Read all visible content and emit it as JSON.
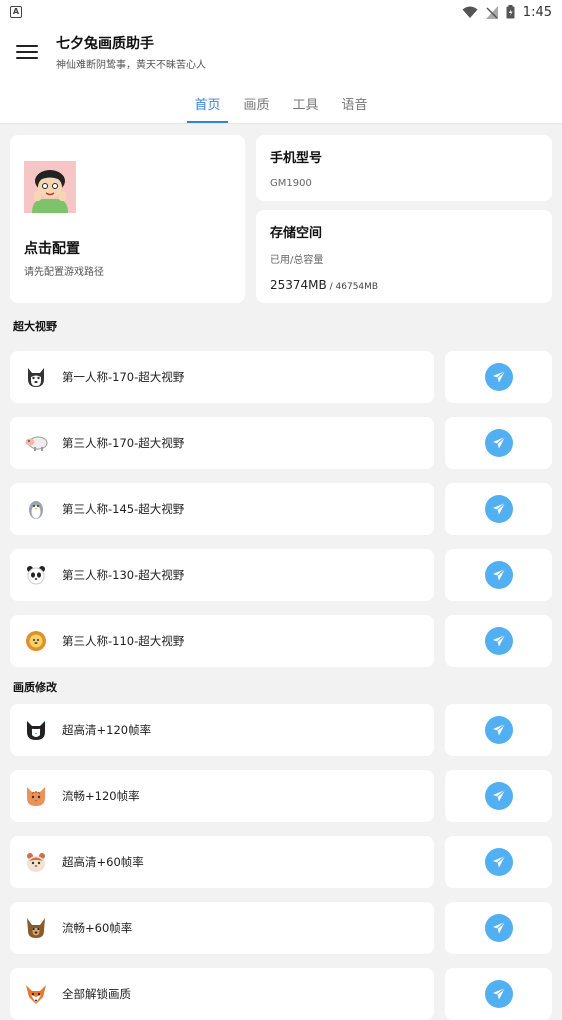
{
  "status_bar": {
    "time": "1:45",
    "app_badge": "A"
  },
  "app": {
    "title": "七夕兔画质助手",
    "subtitle": "神仙难断阴鸷事，黄天不昧苦心人"
  },
  "tabs": [
    {
      "label": "首页",
      "active": true
    },
    {
      "label": "画质",
      "active": false
    },
    {
      "label": "工具",
      "active": false
    },
    {
      "label": "语音",
      "active": false
    }
  ],
  "config_card": {
    "title": "点击配置",
    "subtitle": "请先配置游戏路径"
  },
  "phone_card": {
    "title": "手机型号",
    "model": "GM1900"
  },
  "storage_card": {
    "title": "存储空间",
    "label": "已用/总容量",
    "used": "25374MB",
    "total": " / 46754MB"
  },
  "sections": [
    {
      "title": "超大视野",
      "items": [
        {
          "label": "第一人称-170-超大视野",
          "icon": "husky-icon"
        },
        {
          "label": "第三人称-170-超大视野",
          "icon": "sheep-icon"
        },
        {
          "label": "第三人称-145-超大视野",
          "icon": "penguin-icon"
        },
        {
          "label": "第三人称-130-超大视野",
          "icon": "panda-icon"
        },
        {
          "label": "第三人称-110-超大视野",
          "icon": "lion-icon"
        }
      ]
    },
    {
      "title": "画质修改",
      "items": [
        {
          "label": "超高清+120帧率",
          "icon": "cat-icon"
        },
        {
          "label": "流畅+120帧率",
          "icon": "orange-cat-icon"
        },
        {
          "label": "超高清+60帧率",
          "icon": "hamster-icon"
        },
        {
          "label": "流畅+60帧率",
          "icon": "dog-icon"
        },
        {
          "label": "全部解锁画质",
          "icon": "fox-icon"
        }
      ]
    }
  ],
  "colors": {
    "accent": "#3a82d8",
    "send": "#52b0f2",
    "background": "#f2f2f2"
  }
}
